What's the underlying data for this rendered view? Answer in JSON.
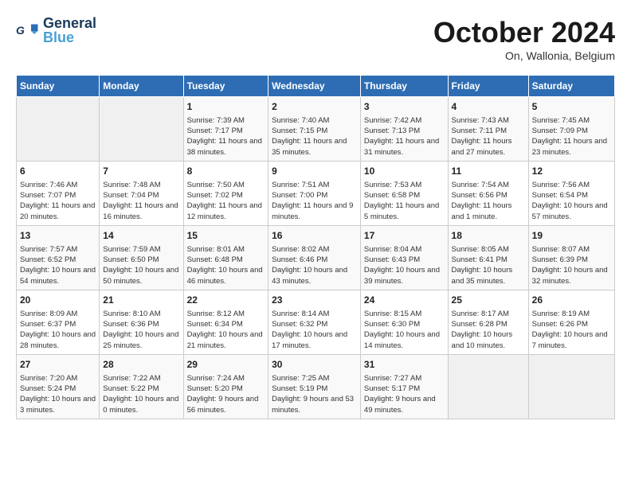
{
  "header": {
    "logo_general": "General",
    "logo_blue": "Blue",
    "month_title": "October 2024",
    "location": "On, Wallonia, Belgium"
  },
  "days_of_week": [
    "Sunday",
    "Monday",
    "Tuesday",
    "Wednesday",
    "Thursday",
    "Friday",
    "Saturday"
  ],
  "weeks": [
    [
      {
        "day": "",
        "info": ""
      },
      {
        "day": "",
        "info": ""
      },
      {
        "day": "1",
        "info": "Sunrise: 7:39 AM\nSunset: 7:17 PM\nDaylight: 11 hours and 38 minutes."
      },
      {
        "day": "2",
        "info": "Sunrise: 7:40 AM\nSunset: 7:15 PM\nDaylight: 11 hours and 35 minutes."
      },
      {
        "day": "3",
        "info": "Sunrise: 7:42 AM\nSunset: 7:13 PM\nDaylight: 11 hours and 31 minutes."
      },
      {
        "day": "4",
        "info": "Sunrise: 7:43 AM\nSunset: 7:11 PM\nDaylight: 11 hours and 27 minutes."
      },
      {
        "day": "5",
        "info": "Sunrise: 7:45 AM\nSunset: 7:09 PM\nDaylight: 11 hours and 23 minutes."
      }
    ],
    [
      {
        "day": "6",
        "info": "Sunrise: 7:46 AM\nSunset: 7:07 PM\nDaylight: 11 hours and 20 minutes."
      },
      {
        "day": "7",
        "info": "Sunrise: 7:48 AM\nSunset: 7:04 PM\nDaylight: 11 hours and 16 minutes."
      },
      {
        "day": "8",
        "info": "Sunrise: 7:50 AM\nSunset: 7:02 PM\nDaylight: 11 hours and 12 minutes."
      },
      {
        "day": "9",
        "info": "Sunrise: 7:51 AM\nSunset: 7:00 PM\nDaylight: 11 hours and 9 minutes."
      },
      {
        "day": "10",
        "info": "Sunrise: 7:53 AM\nSunset: 6:58 PM\nDaylight: 11 hours and 5 minutes."
      },
      {
        "day": "11",
        "info": "Sunrise: 7:54 AM\nSunset: 6:56 PM\nDaylight: 11 hours and 1 minute."
      },
      {
        "day": "12",
        "info": "Sunrise: 7:56 AM\nSunset: 6:54 PM\nDaylight: 10 hours and 57 minutes."
      }
    ],
    [
      {
        "day": "13",
        "info": "Sunrise: 7:57 AM\nSunset: 6:52 PM\nDaylight: 10 hours and 54 minutes."
      },
      {
        "day": "14",
        "info": "Sunrise: 7:59 AM\nSunset: 6:50 PM\nDaylight: 10 hours and 50 minutes."
      },
      {
        "day": "15",
        "info": "Sunrise: 8:01 AM\nSunset: 6:48 PM\nDaylight: 10 hours and 46 minutes."
      },
      {
        "day": "16",
        "info": "Sunrise: 8:02 AM\nSunset: 6:46 PM\nDaylight: 10 hours and 43 minutes."
      },
      {
        "day": "17",
        "info": "Sunrise: 8:04 AM\nSunset: 6:43 PM\nDaylight: 10 hours and 39 minutes."
      },
      {
        "day": "18",
        "info": "Sunrise: 8:05 AM\nSunset: 6:41 PM\nDaylight: 10 hours and 35 minutes."
      },
      {
        "day": "19",
        "info": "Sunrise: 8:07 AM\nSunset: 6:39 PM\nDaylight: 10 hours and 32 minutes."
      }
    ],
    [
      {
        "day": "20",
        "info": "Sunrise: 8:09 AM\nSunset: 6:37 PM\nDaylight: 10 hours and 28 minutes."
      },
      {
        "day": "21",
        "info": "Sunrise: 8:10 AM\nSunset: 6:36 PM\nDaylight: 10 hours and 25 minutes."
      },
      {
        "day": "22",
        "info": "Sunrise: 8:12 AM\nSunset: 6:34 PM\nDaylight: 10 hours and 21 minutes."
      },
      {
        "day": "23",
        "info": "Sunrise: 8:14 AM\nSunset: 6:32 PM\nDaylight: 10 hours and 17 minutes."
      },
      {
        "day": "24",
        "info": "Sunrise: 8:15 AM\nSunset: 6:30 PM\nDaylight: 10 hours and 14 minutes."
      },
      {
        "day": "25",
        "info": "Sunrise: 8:17 AM\nSunset: 6:28 PM\nDaylight: 10 hours and 10 minutes."
      },
      {
        "day": "26",
        "info": "Sunrise: 8:19 AM\nSunset: 6:26 PM\nDaylight: 10 hours and 7 minutes."
      }
    ],
    [
      {
        "day": "27",
        "info": "Sunrise: 7:20 AM\nSunset: 5:24 PM\nDaylight: 10 hours and 3 minutes."
      },
      {
        "day": "28",
        "info": "Sunrise: 7:22 AM\nSunset: 5:22 PM\nDaylight: 10 hours and 0 minutes."
      },
      {
        "day": "29",
        "info": "Sunrise: 7:24 AM\nSunset: 5:20 PM\nDaylight: 9 hours and 56 minutes."
      },
      {
        "day": "30",
        "info": "Sunrise: 7:25 AM\nSunset: 5:19 PM\nDaylight: 9 hours and 53 minutes."
      },
      {
        "day": "31",
        "info": "Sunrise: 7:27 AM\nSunset: 5:17 PM\nDaylight: 9 hours and 49 minutes."
      },
      {
        "day": "",
        "info": ""
      },
      {
        "day": "",
        "info": ""
      }
    ]
  ]
}
